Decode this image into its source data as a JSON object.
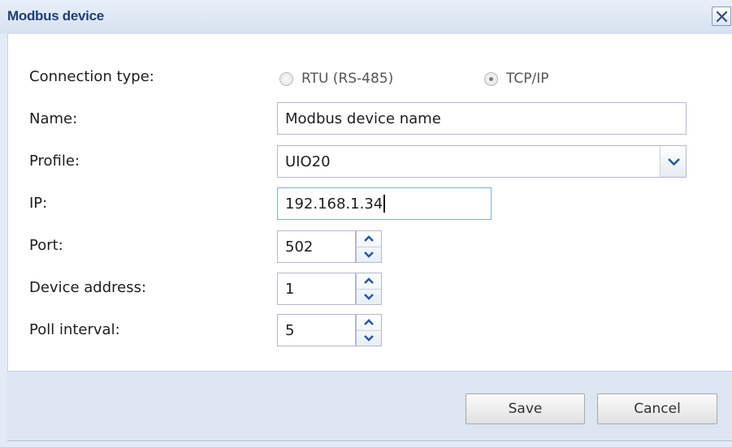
{
  "dialog": {
    "title": "Modbus device"
  },
  "form": {
    "connection_type": {
      "label": "Connection type:",
      "options": [
        "RTU (RS-485)",
        "TCP/IP"
      ],
      "selected": "TCP/IP"
    },
    "name": {
      "label": "Name:",
      "value": "Modbus device name"
    },
    "profile": {
      "label": "Profile:",
      "value": "UIO20"
    },
    "ip": {
      "label": "IP:",
      "value": "192.168.1.34"
    },
    "port": {
      "label": "Port:",
      "value": "502"
    },
    "device_address": {
      "label": "Device address:",
      "value": "1"
    },
    "poll_interval": {
      "label": "Poll interval:",
      "value": "5"
    }
  },
  "footer": {
    "save_label": "Save",
    "cancel_label": "Cancel"
  },
  "icons": {
    "close": "close-icon",
    "dropdown": "chevron-down-icon",
    "spinner_up": "chevron-up-icon",
    "spinner_down": "chevron-down-icon"
  },
  "colors": {
    "title_text": "#1f3f73",
    "frame": "#e3ebf6",
    "footer": "#dce5f1",
    "arrow": "#2b5aa0"
  }
}
